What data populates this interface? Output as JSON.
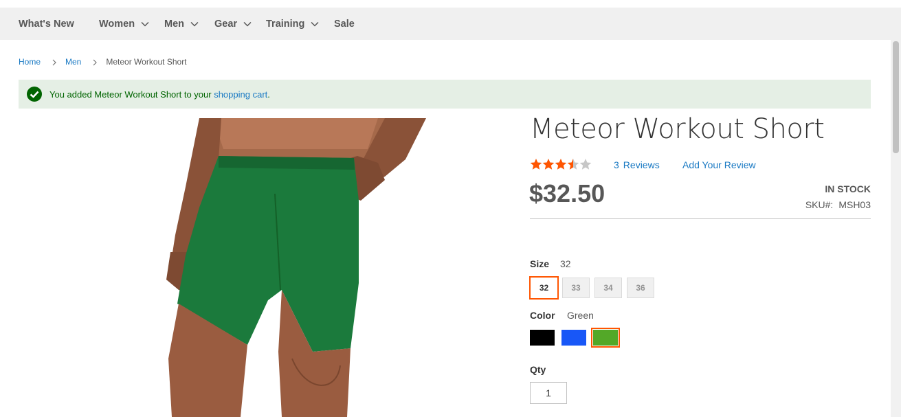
{
  "nav": {
    "items": [
      {
        "label": "What's New",
        "has_dropdown": false
      },
      {
        "label": "Women",
        "has_dropdown": true
      },
      {
        "label": "Men",
        "has_dropdown": true
      },
      {
        "label": "Gear",
        "has_dropdown": true
      },
      {
        "label": "Training",
        "has_dropdown": true
      },
      {
        "label": "Sale",
        "has_dropdown": false
      }
    ]
  },
  "breadcrumb": {
    "home": "Home",
    "category": "Men",
    "current": "Meteor Workout Short"
  },
  "message": {
    "prefix": "You added Meteor Workout Short to your ",
    "link": "shopping cart",
    "suffix": ".",
    "icon": "check-circle-icon"
  },
  "product": {
    "title": "Meteor Workout Short",
    "rating_fraction": 0.7,
    "stars_total": 5,
    "reviews_count": "3",
    "reviews_label": "Reviews",
    "add_review": "Add Your Review",
    "price": "$32.50",
    "stock": "IN STOCK",
    "sku_label": "SKU#:",
    "sku_value": "MSH03",
    "image_alt": "green workout shorts on model"
  },
  "options": {
    "size_label": "Size",
    "size_selected": "32",
    "sizes": [
      "32",
      "33",
      "34",
      "36"
    ],
    "color_label": "Color",
    "color_selected": "Green",
    "colors": [
      {
        "name": "Black",
        "hex": "#000000"
      },
      {
        "name": "Blue",
        "hex": "#1857f7"
      },
      {
        "name": "Green",
        "hex": "#53a828"
      }
    ],
    "qty_label": "Qty",
    "qty_value": "1"
  },
  "colors": {
    "accent": "#ff5501",
    "link": "#1979c3",
    "star": "#ff5501",
    "success_bg": "#e5efe5",
    "success_text": "#006400"
  }
}
